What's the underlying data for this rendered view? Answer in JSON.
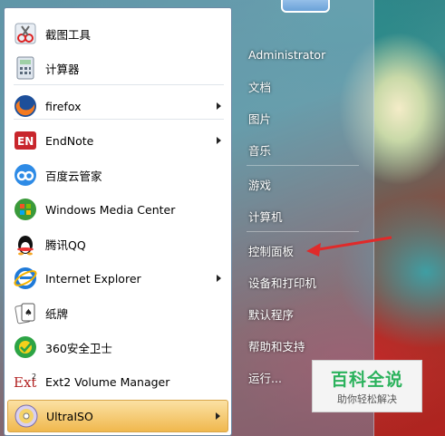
{
  "left_pane": {
    "items": [
      {
        "label": "截图工具",
        "icon": "scissors-icon",
        "submenu": false
      },
      {
        "label": "计算器",
        "icon": "calculator-icon",
        "submenu": false
      },
      {
        "label": "firefox",
        "icon": "firefox-icon",
        "submenu": true
      },
      {
        "label": "EndNote",
        "icon": "endnote-icon",
        "submenu": true
      },
      {
        "label": "百度云管家",
        "icon": "baidu-cloud-icon",
        "submenu": false
      },
      {
        "label": "Windows Media Center",
        "icon": "windows-logo-icon",
        "submenu": false
      },
      {
        "label": "腾讯QQ",
        "icon": "qq-penguin-icon",
        "submenu": false
      },
      {
        "label": "Internet Explorer",
        "icon": "internet-explorer-icon",
        "submenu": true
      },
      {
        "label": "纸牌",
        "icon": "cards-icon",
        "submenu": false
      },
      {
        "label": "360安全卫士",
        "icon": "360-shield-icon",
        "submenu": false
      },
      {
        "label": "Ext2 Volume Manager",
        "icon": "ext2-icon",
        "submenu": false
      },
      {
        "label": "UltraISO",
        "icon": "disc-icon",
        "submenu": true,
        "selected": true
      }
    ]
  },
  "right_pane": {
    "items": [
      {
        "label": "Administrator"
      },
      {
        "label": "文档"
      },
      {
        "label": "图片"
      },
      {
        "label": "音乐"
      },
      {
        "label": "游戏"
      },
      {
        "label": "计算机"
      },
      {
        "label": "控制面板"
      },
      {
        "label": "设备和打印机"
      },
      {
        "label": "默认程序"
      },
      {
        "label": "帮助和支持"
      },
      {
        "label": "运行..."
      }
    ]
  },
  "annotation": {
    "arrow_color": "#e02a2a",
    "points_to": "控制面板"
  },
  "watermark": {
    "title": "百科全说",
    "subtitle": "助你轻松解决"
  },
  "colors": {
    "selection": "#f0b84e",
    "watermark_green": "#2bb25c"
  }
}
